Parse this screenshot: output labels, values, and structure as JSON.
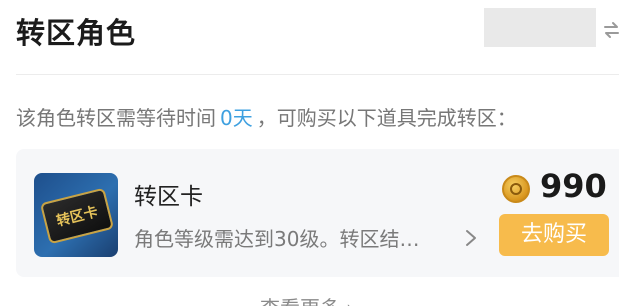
{
  "header": {
    "title": "转区角色"
  },
  "notice": {
    "prefix": "该角色转区需等待时间",
    "days": "0天",
    "suffix": "，可购买以下道具完成转区："
  },
  "item": {
    "thumbnail_text": "转区卡",
    "name": "转区卡",
    "description": "角色等级需达到30级。转区结…",
    "price": "990",
    "buy_label": "去购买"
  },
  "footer": {
    "more_label": "查看更多"
  },
  "colors": {
    "accent_blue": "#3ea0e0",
    "buy_button": "#f7bb4c",
    "card_bg": "#f6f7f9"
  }
}
